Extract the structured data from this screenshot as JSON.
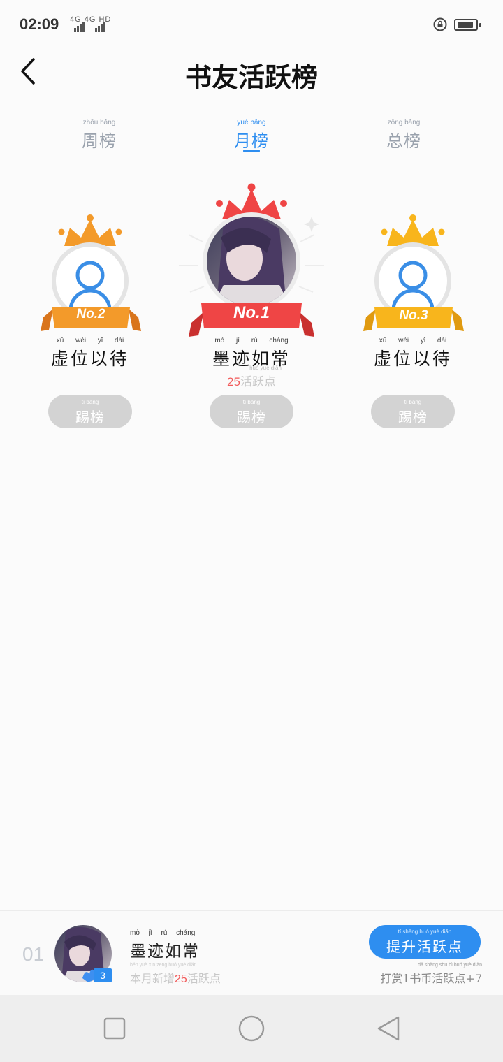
{
  "status": {
    "time": "02:09",
    "network": "4G 4G HD"
  },
  "header": {
    "title": "书友活跃榜"
  },
  "tabs": [
    {
      "pinyin": "zhōu  bǎng",
      "label": "周榜",
      "active": false
    },
    {
      "pinyin": "yuè  bǎng",
      "label": "月榜",
      "active": true
    },
    {
      "pinyin": "zǒng  bǎng",
      "label": "总榜",
      "active": false
    }
  ],
  "podium": {
    "first": {
      "rank_label": "No.1",
      "name_pinyin": "mò jì rú cháng",
      "name": "墨迹如常",
      "points_pinyin": "huó yuè diǎn",
      "points_value": "25",
      "points_suffix": "活跃点",
      "kick_pinyin": "tī  bǎng",
      "kick_label": "踢榜"
    },
    "second": {
      "rank_label": "No.2",
      "name_pinyin": "xū wèi yǐ dài",
      "name": "虚位以待",
      "kick_pinyin": "tī  bǎng",
      "kick_label": "踢榜"
    },
    "third": {
      "rank_label": "No.3",
      "name_pinyin": "xū wèi yǐ dài",
      "name": "虚位以待",
      "kick_pinyin": "tī  bǎng",
      "kick_label": "踢榜"
    }
  },
  "me": {
    "rank": "01",
    "level": "3",
    "name_pinyin": "mò jì rú cháng",
    "name": "墨迹如常",
    "sub_pinyin": "běn yuè xīn zēng      huó yuè diǎn",
    "sub_prefix": "本月新增",
    "sub_value": "25",
    "sub_suffix": "活跃点",
    "boost_pinyin": "tí shēng huó yuè diǎn",
    "boost_label": "提升活跃点",
    "reward_pinyin": "dǎ shǎng   shū bì huó yuè diǎn",
    "reward_label": "打赏1书币活跃点+7"
  },
  "colors": {
    "accent": "#2e8ef0",
    "gold_first": "#ef4545",
    "silver_second": "#f39a2a",
    "bronze_third": "#f8b51c"
  }
}
